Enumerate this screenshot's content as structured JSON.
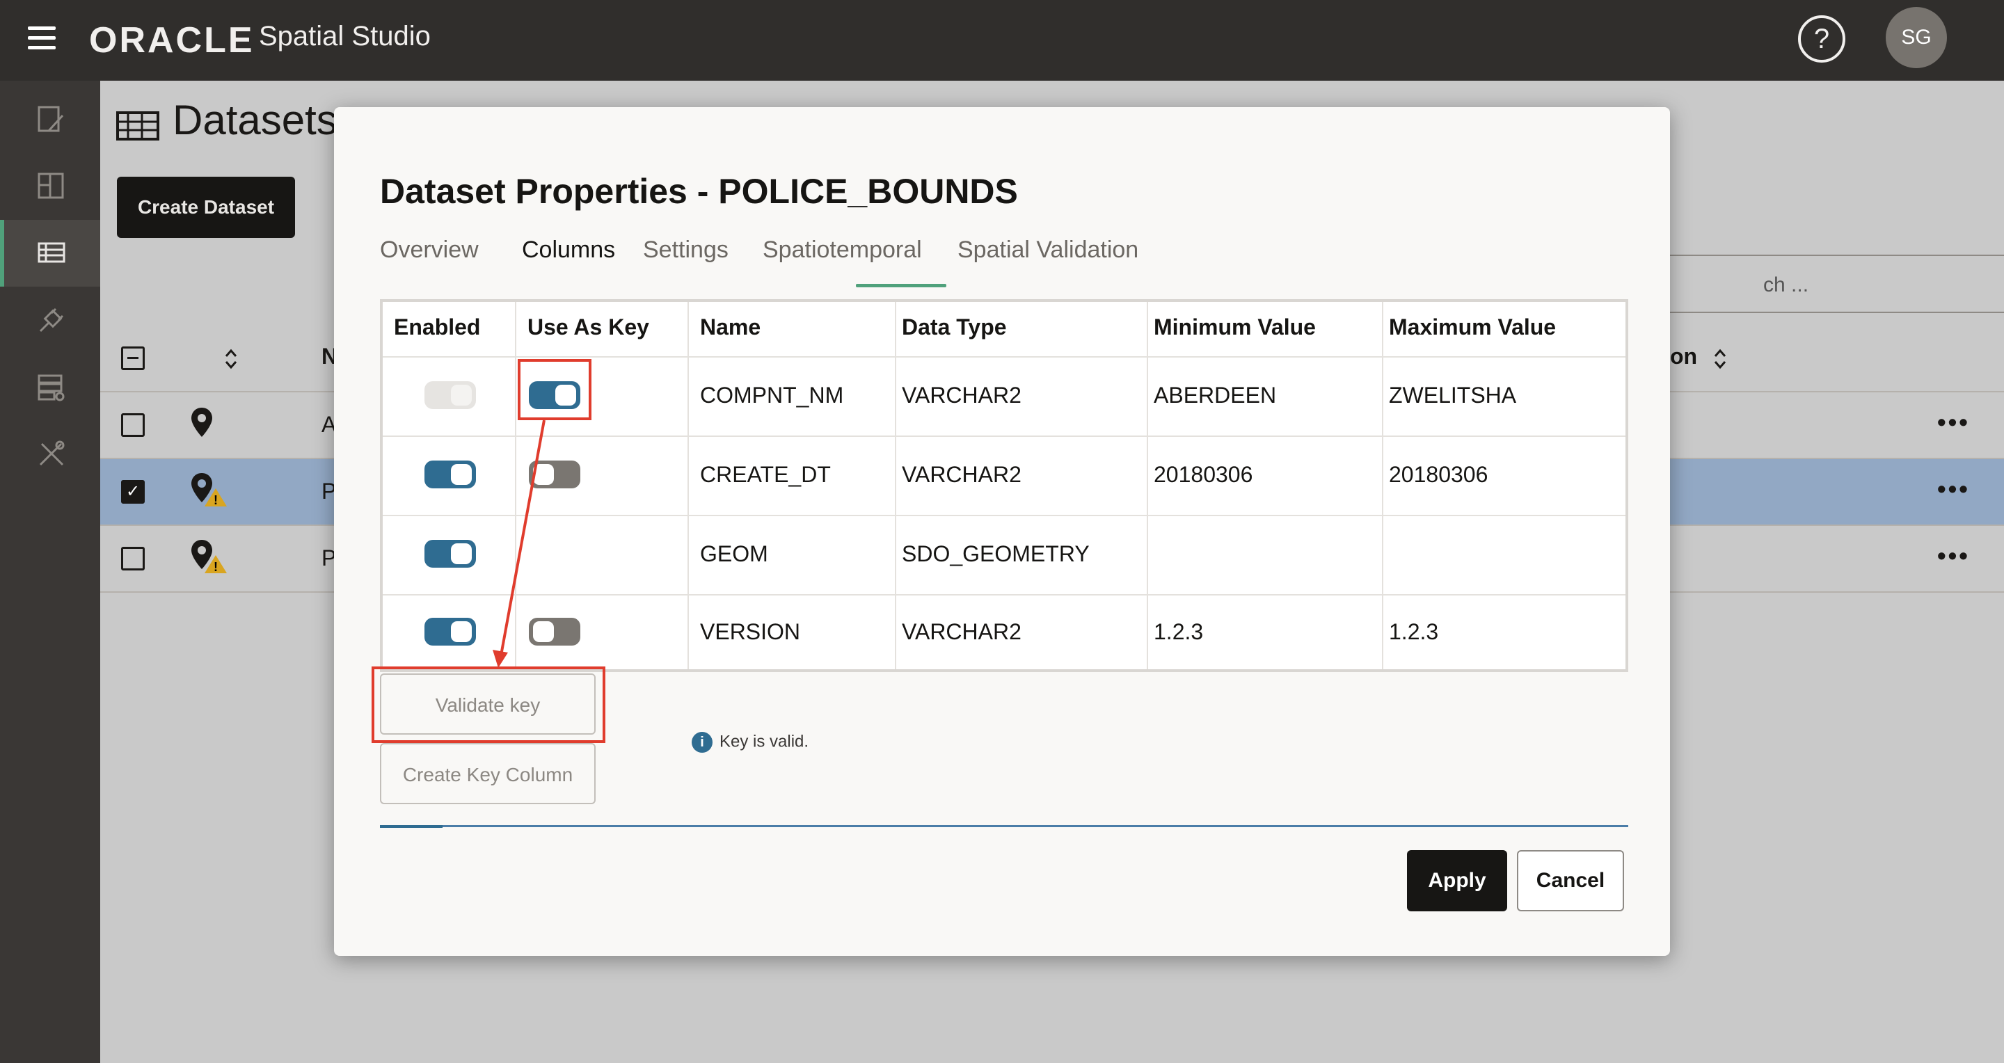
{
  "app": {
    "brand": "ORACLE",
    "product": "Spatial Studio",
    "help_glyph": "?",
    "user_initials": "SG"
  },
  "sidebar": {
    "items": [
      {
        "icon": "project-edit-icon"
      },
      {
        "icon": "dashboard-icon"
      },
      {
        "icon": "datasets-table-icon",
        "active": true
      },
      {
        "icon": "connections-plug-icon"
      },
      {
        "icon": "data-server-icon"
      },
      {
        "icon": "tools-icon"
      }
    ]
  },
  "page": {
    "title": "Datasets",
    "create_button": "Create Dataset",
    "search_placeholder": "ch ...",
    "header_partial_left": "N",
    "header_partial_right": "on",
    "rows": [
      {
        "letter": "A",
        "checked": false,
        "warning": false
      },
      {
        "letter": "P",
        "checked": true,
        "warning": true
      },
      {
        "letter": "P",
        "checked": false,
        "warning": true
      }
    ],
    "row_actions_glyph": "•••"
  },
  "modal": {
    "title": "Dataset Properties - POLICE_BOUNDS",
    "tabs": [
      {
        "label": "Overview",
        "active": false
      },
      {
        "label": "Columns",
        "active": true
      },
      {
        "label": "Settings",
        "active": false
      },
      {
        "label": "Spatiotemporal",
        "active": false
      },
      {
        "label": "Spatial Validation",
        "active": false
      }
    ],
    "columns": [
      "Enabled",
      "Use As Key",
      "Name",
      "Data Type",
      "Minimum Value",
      "Maximum Value"
    ],
    "rows": [
      {
        "enabled": "disabled-on",
        "key": "on",
        "name": "COMPNT_NM",
        "type": "VARCHAR2",
        "min": "ABERDEEN",
        "max": "ZWELITSHA"
      },
      {
        "enabled": "on",
        "key": "off",
        "name": "CREATE_DT",
        "type": "VARCHAR2",
        "min": "20180306",
        "max": "20180306"
      },
      {
        "enabled": "on",
        "key": "none",
        "name": "GEOM",
        "type": "SDO_GEOMETRY",
        "min": "",
        "max": ""
      },
      {
        "enabled": "on",
        "key": "off",
        "name": "VERSION",
        "type": "VARCHAR2",
        "min": "1.2.3",
        "max": "1.2.3"
      }
    ],
    "validate_button": "Validate key",
    "create_key_button": "Create Key Column",
    "info_glyph": "i",
    "info_message": "Key is valid.",
    "progress_fraction": 0.05,
    "apply_button": "Apply",
    "cancel_button": "Cancel"
  },
  "colors": {
    "toggle_on": "#2f6c91",
    "annotation": "#e03c2d",
    "tab_underline": "#50a17b"
  }
}
